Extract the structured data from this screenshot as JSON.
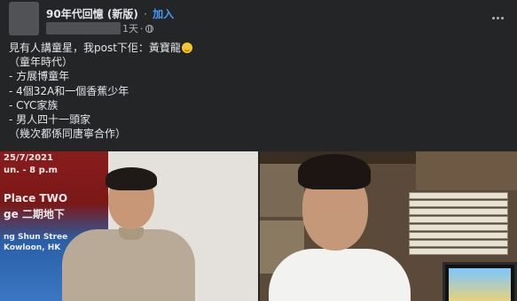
{
  "header": {
    "group_name": "90年代回憶 (新版)",
    "separator": "·",
    "join_label": "加入",
    "time": "1天",
    "time_dot": "·"
  },
  "post": {
    "lines": [
      "見有人講童星，我post下佢：黃寶龍",
      "（童年時代）",
      "- 方展博童年",
      "- 4個32A和一個香蕉少年",
      "- CYC家族",
      "- 男人四十一頭家",
      "（幾次都係同唐寧合作）"
    ]
  },
  "photos": {
    "poster_lines": [
      "25/7/2021",
      "un. - 8 p.m",
      "Place TWO",
      "ge 二期地下",
      "ng Shun Stree",
      "Kowloon, HK"
    ]
  },
  "icons": {
    "globe": "globe-icon",
    "more": "more-options-icon",
    "emoji": "grinning-face-emoji"
  }
}
